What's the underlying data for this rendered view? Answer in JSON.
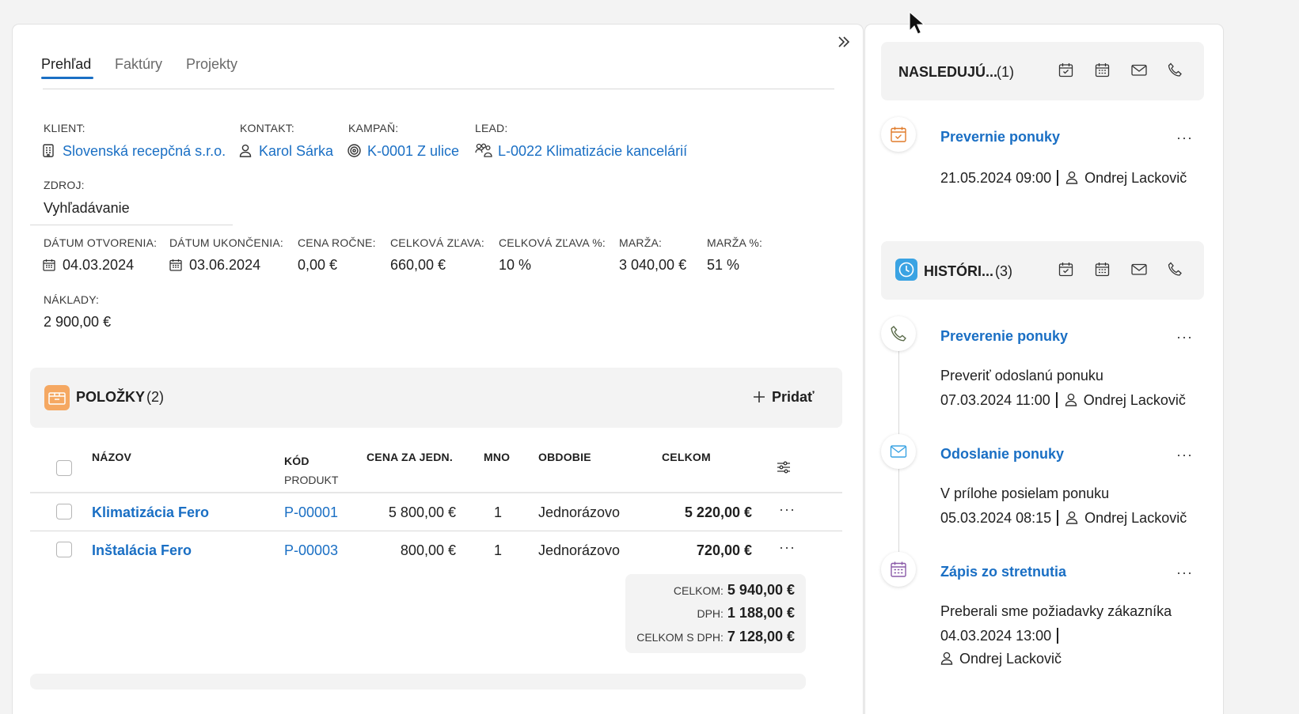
{
  "tabs": [
    "Prehľad",
    "Faktúry",
    "Projekty"
  ],
  "fields": {
    "klient_label": "KLIENT:",
    "klient_value": "Slovenská recepčná s.r.o.",
    "kontakt_label": "KONTAKT:",
    "kontakt_value": "Karol Sárka",
    "kampan_label": "KAMPAŇ:",
    "kampan_value": "K-0001 Z ulice",
    "lead_label": "LEAD:",
    "lead_value": "L-0022 Klimatizácie kancelárií",
    "zdroj_label": "ZDROJ:",
    "zdroj_value": "Vyhľadávanie",
    "datum_otvorenia_label": "DÁTUM OTVORENIA:",
    "datum_otvorenia_value": "04.03.2024",
    "datum_ukoncenia_label": "DÁTUM UKONČENIA:",
    "datum_ukoncenia_value": "03.06.2024",
    "cena_rocne_label": "CENA ROČNE:",
    "cena_rocne_value": "0,00 €",
    "celkova_zlava_label": "CELKOVÁ ZĽAVA:",
    "celkova_zlava_value": "660,00 €",
    "celkova_zlava_pct_label": "CELKOVÁ ZĽAVA %:",
    "celkova_zlava_pct_value": "10 %",
    "marza_label": "MARŽA:",
    "marza_value": "3 040,00 €",
    "marza_pct_label": "MARŽA %:",
    "marza_pct_value": "51 %",
    "naklady_label": "NÁKLADY:",
    "naklady_value": "2 900,00 €"
  },
  "items": {
    "title": "POLOŽKY",
    "count": "(2)",
    "add_label": "Pridať",
    "columns": {
      "nazov": "NÁZOV",
      "kod": "KÓD",
      "kod_sub": "PRODUKT",
      "cena": "CENA ZA JEDN.",
      "mno": "MNO",
      "obdobie": "OBDOBIE",
      "celkom": "CELKOM"
    },
    "rows": [
      {
        "nazov": "Klimatizácia Fero",
        "kod": "P-00001",
        "cena": "5 800,00 €",
        "mno": "1",
        "obdobie": "Jednorázovo",
        "celkom": "5 220,00 €",
        "more": "···"
      },
      {
        "nazov": "Inštalácia Fero",
        "kod": "P-00003",
        "cena": "800,00 €",
        "mno": "1",
        "obdobie": "Jednorázovo",
        "celkom": "720,00 €",
        "more": "···"
      }
    ],
    "totals": {
      "celkom_label": "CELKOM:",
      "celkom_value": "5 940,00 €",
      "dph_label": "DPH:",
      "dph_value": "1 188,00 €",
      "s_dph_label": "CELKOM S DPH:",
      "s_dph_value": "7 128,00 €"
    }
  },
  "sidebar": {
    "upcoming": {
      "title": "NASLEDUJÚ...",
      "count": "(1)",
      "activities": [
        {
          "title": "Prevernie ponuky",
          "datetime": "21.05.2024 09:00",
          "user": "Ondrej Lackovič",
          "more": "···",
          "icon": "calendar-check-icon",
          "icon_color": "#e07b2a"
        }
      ]
    },
    "history": {
      "title": "HISTÓRI...",
      "count": "(3)",
      "activities": [
        {
          "title": "Preverenie ponuky",
          "desc": "Preveriť odoslanú ponuku",
          "datetime": "07.03.2024 11:00",
          "user": "Ondrej Lackovič",
          "more": "···",
          "icon": "phone-icon",
          "icon_color": "#5a6b4a"
        },
        {
          "title": "Odoslanie ponuky",
          "desc": "V prílohe posielam ponuku",
          "datetime": "05.03.2024 08:15",
          "user": "Ondrej Lackovič",
          "more": "···",
          "icon": "mail-icon",
          "icon_color": "#3aa3e3"
        },
        {
          "title": "Zápis zo stretnutia",
          "desc": "Preberali sme požiadavky zákazníka",
          "datetime": "04.03.2024 13:00",
          "user": "Ondrej Lackovič",
          "more": "···",
          "icon": "calendar-icon",
          "icon_color": "#8a5aa8"
        }
      ]
    }
  },
  "colors": {
    "link": "#1a6fc4",
    "items_badge": "#f5a862",
    "history_badge": "#3aa3e3",
    "section_bg": "#f3f3f3"
  }
}
